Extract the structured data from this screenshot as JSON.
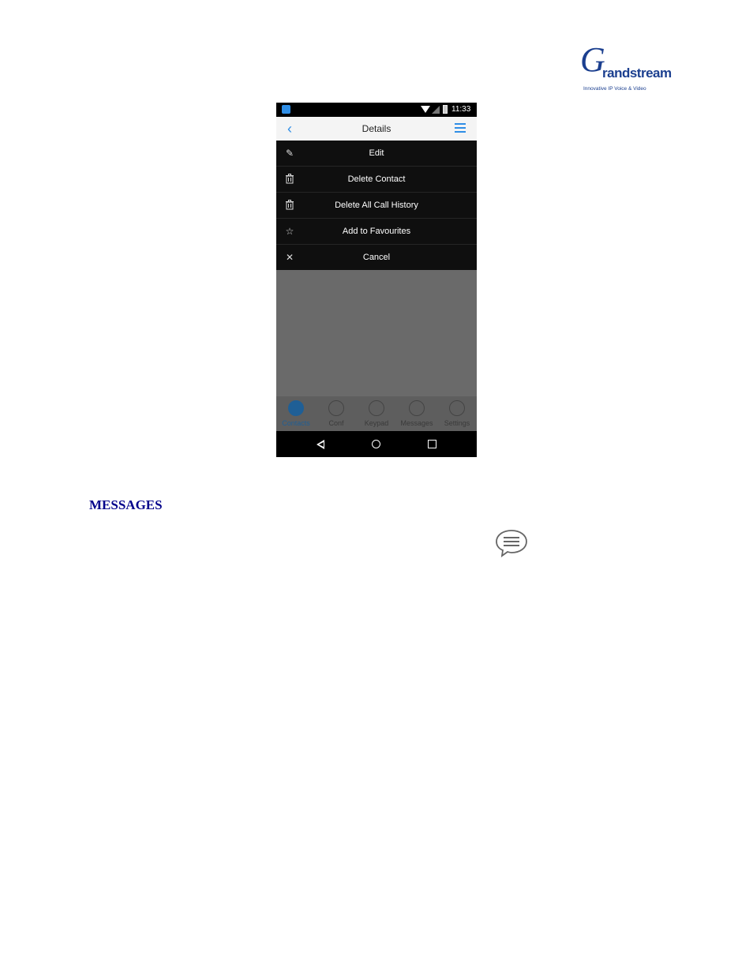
{
  "logo": {
    "name": "Grandstream",
    "g_letter": "G",
    "rest": "randstream",
    "tagline": "Innovative IP Voice & Video"
  },
  "phone": {
    "status_bar": {
      "time": "11:33"
    },
    "header": {
      "title": "Details"
    },
    "menu": [
      {
        "label": "Edit",
        "icon": "pencil-icon"
      },
      {
        "label": "Delete Contact",
        "icon": "trash-icon"
      },
      {
        "label": "Delete All Call History",
        "icon": "trash-icon"
      },
      {
        "label": "Add to Favourites",
        "icon": "star-icon"
      },
      {
        "label": "Cancel",
        "icon": "close-icon"
      }
    ],
    "tabs": [
      {
        "label": "Contacts",
        "icon": "person-icon",
        "active": true
      },
      {
        "label": "Conf",
        "icon": "people-icon",
        "active": false
      },
      {
        "label": "Keypad",
        "icon": "keypad-icon",
        "active": false
      },
      {
        "label": "Messages",
        "icon": "chat-bubble-icon",
        "active": false
      },
      {
        "label": "Settings",
        "icon": "gear-icon",
        "active": false
      }
    ],
    "colors": {
      "accent": "#2f8ee6",
      "active_tab": "#1f5f96",
      "menu_bg": "#0f0f0f"
    }
  },
  "document": {
    "heading": "MESSAGES",
    "inline_icon": "messages-bubble-icon"
  }
}
